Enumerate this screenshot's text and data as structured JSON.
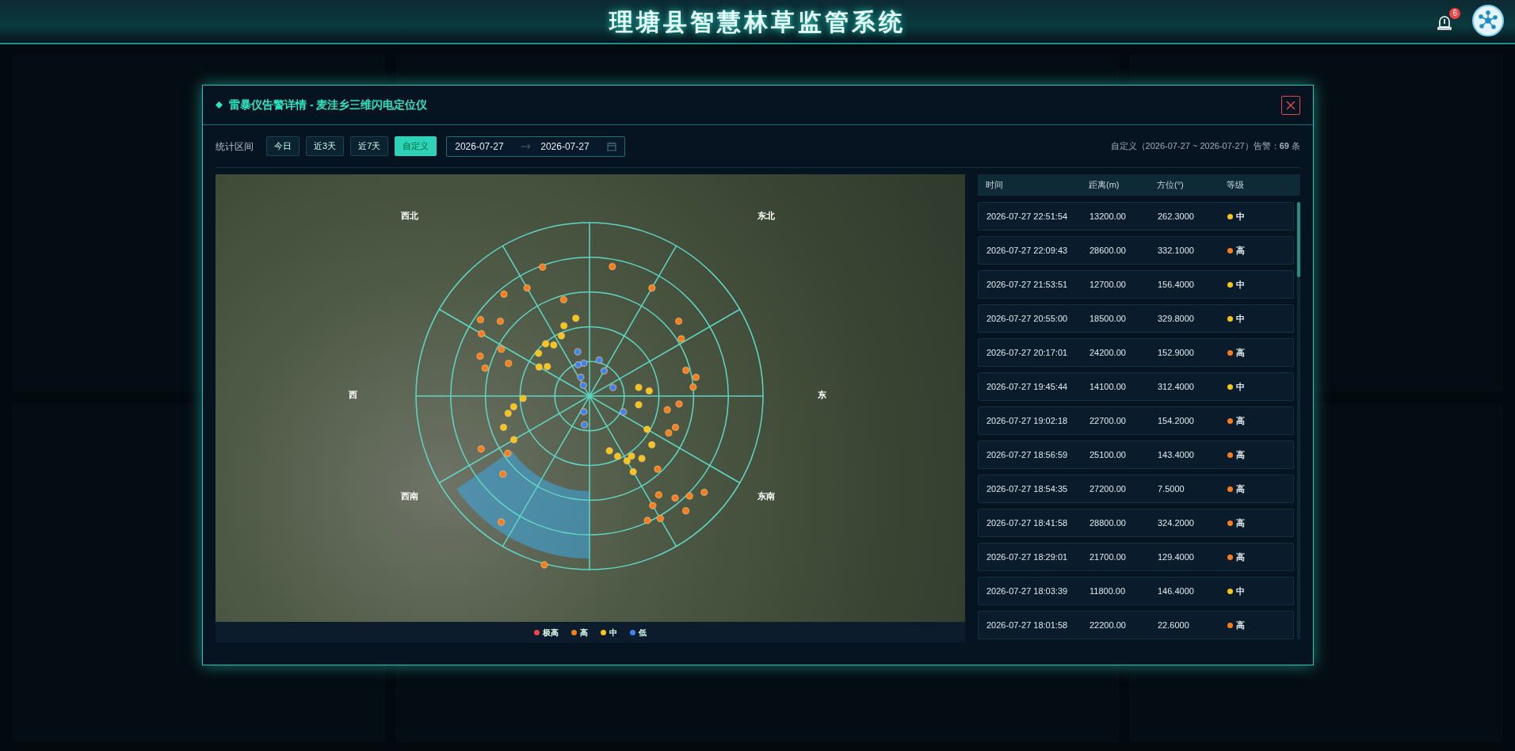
{
  "header": {
    "title": "理塘县智慧林草监管系统",
    "alert_count": "6"
  },
  "dialog": {
    "title": "雷暴仪告警详情 - 麦洼乡三维闪电定位仪",
    "range_label": "统计区间",
    "ranges": [
      {
        "label": "今日",
        "selected": false
      },
      {
        "label": "近3天",
        "selected": false
      },
      {
        "label": "近7天",
        "selected": false
      },
      {
        "label": "自定义",
        "selected": true
      }
    ],
    "date_start": "2026-07-27",
    "date_end": "2026-07-27",
    "summary": "自定义（2026-07-27 ~ 2026-07-27）告警：**69** 条",
    "chart": {
      "directions": [
        "西北",
        "东北",
        "西",
        "东",
        "西南",
        "东南"
      ],
      "legend": [
        {
          "label": "极高",
          "color": "#ef4444"
        },
        {
          "label": "高",
          "color": "#f57c1f"
        },
        {
          "label": "中",
          "color": "#f5c518"
        },
        {
          "label": "低",
          "color": "#3b82f6"
        }
      ]
    },
    "table": {
      "columns": [
        "时间",
        "距离(m)",
        "方位(°)",
        "等级"
      ],
      "rows": [
        {
          "time": "2026-07-27 22:51:54",
          "distance": "13200.00",
          "bearing": "262.3000",
          "level": "中",
          "color": "#f5c518"
        },
        {
          "time": "2026-07-27 22:09:43",
          "distance": "28600.00",
          "bearing": "332.1000",
          "level": "高",
          "color": "#f57c1f"
        },
        {
          "time": "2026-07-27 21:53:51",
          "distance": "12700.00",
          "bearing": "156.4000",
          "level": "中",
          "color": "#f5c518"
        },
        {
          "time": "2026-07-27 20:55:00",
          "distance": "18500.00",
          "bearing": "329.8000",
          "level": "中",
          "color": "#f5c518"
        },
        {
          "time": "2026-07-27 20:17:01",
          "distance": "24200.00",
          "bearing": "152.9000",
          "level": "高",
          "color": "#f57c1f"
        },
        {
          "time": "2026-07-27 19:45:44",
          "distance": "14100.00",
          "bearing": "312.4000",
          "level": "中",
          "color": "#f5c518"
        },
        {
          "time": "2026-07-27 19:02:18",
          "distance": "22700.00",
          "bearing": "154.2000",
          "level": "高",
          "color": "#f57c1f"
        },
        {
          "time": "2026-07-27 18:56:59",
          "distance": "25100.00",
          "bearing": "143.4000",
          "level": "高",
          "color": "#f57c1f"
        },
        {
          "time": "2026-07-27 18:54:35",
          "distance": "27200.00",
          "bearing": "7.5000",
          "level": "高",
          "color": "#f57c1f"
        },
        {
          "time": "2026-07-27 18:41:58",
          "distance": "28800.00",
          "bearing": "324.2000",
          "level": "高",
          "color": "#f57c1f"
        },
        {
          "time": "2026-07-27 18:29:01",
          "distance": "21700.00",
          "bearing": "129.4000",
          "level": "高",
          "color": "#f57c1f"
        },
        {
          "time": "2026-07-27 18:03:39",
          "distance": "11800.00",
          "bearing": "146.4000",
          "level": "中",
          "color": "#f5c518"
        },
        {
          "time": "2026-07-27 18:01:58",
          "distance": "22200.00",
          "bearing": "22.6000",
          "level": "高",
          "color": "#f57c1f"
        }
      ]
    }
  }
}
